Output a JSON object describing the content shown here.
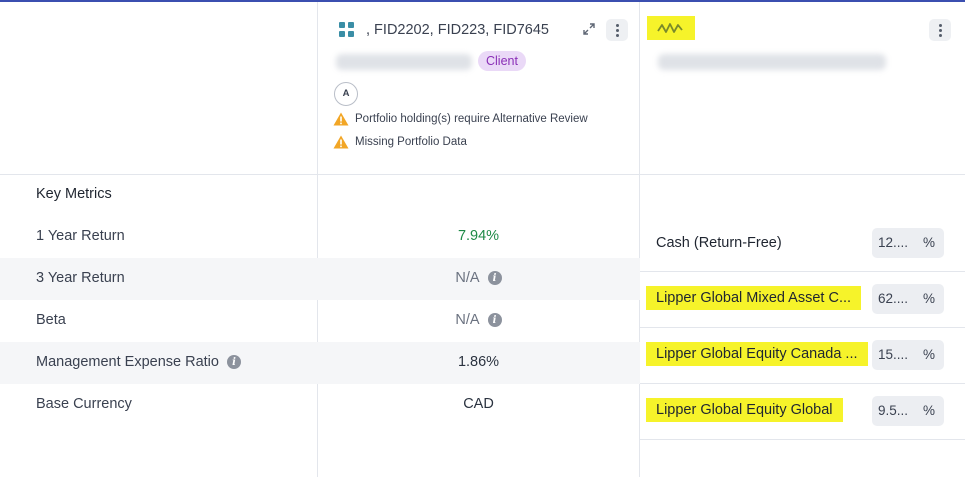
{
  "portfolio": {
    "title": ", FID2202, FID223, FID7645",
    "badge": "Client",
    "avatar_initial": "A",
    "warnings": [
      "Portfolio holding(s) require Alternative Review",
      "Missing Portfolio Data"
    ],
    "icons": {
      "type": "grid-icon",
      "expand": "expand-icon",
      "menu": "kebab-menu-icon",
      "warning": "warning-icon"
    }
  },
  "benchmark": {
    "icons": {
      "type": "wave-icon",
      "menu": "kebab-menu-icon"
    },
    "rows": [
      {
        "name": "Cash (Return-Free)",
        "pct": "12....",
        "symbol": "%"
      },
      {
        "name": "Lipper Global Mixed Asset C...",
        "pct": "62....",
        "symbol": "%"
      },
      {
        "name": "Lipper Global Equity Canada ...",
        "pct": "15....",
        "symbol": "%"
      },
      {
        "name": "Lipper Global Equity Global",
        "pct": "9.5...",
        "symbol": "%"
      }
    ]
  },
  "metrics": {
    "header": "Key Metrics",
    "rows": [
      {
        "label": "1 Year Return",
        "value": "7.94%"
      },
      {
        "label": "3 Year Return",
        "value": "N/A"
      },
      {
        "label": "Beta",
        "value": "N/A"
      },
      {
        "label": "Management Expense Ratio",
        "value": "1.86%"
      },
      {
        "label": "Base Currency",
        "value": "CAD"
      }
    ]
  },
  "colors": {
    "accent_line": "#3b4fb0",
    "positive": "#1e8a47",
    "badge_bg": "#ead9f7",
    "badge_text": "#8a2fb7",
    "highlight": "#f6f32a",
    "warning": "#f2a626"
  }
}
